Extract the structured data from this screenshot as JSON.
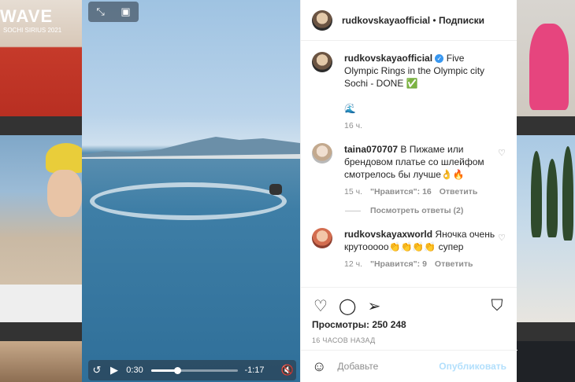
{
  "background": {
    "wave_title": "WAVE",
    "wave_subtitle": "SOCHI SIRIUS 2021"
  },
  "video": {
    "current_time": "0:30",
    "remaining_time": "-1:17",
    "progress": 0.3,
    "icons": [
      "expand-icon",
      "pip-icon",
      "replay-icon",
      "play-icon",
      "more-icon",
      "mute-icon"
    ]
  },
  "post": {
    "author": "rudkovskayaofficial",
    "header_separator": "•",
    "follow_label": "Подписки",
    "caption": {
      "username": "rudkovskayaofficial",
      "text": "Five Olympic Rings in the Olympic city Sochi - DONE ✅",
      "emoji": "🌊",
      "time": "16 ч."
    },
    "comments": [
      {
        "username": "taina070707",
        "text": "В Пижаме или брендовом платье со шлейфом смотрелось бы лучше👌🔥",
        "time": "15 ч.",
        "likes": "\"Нравится\": 16",
        "reply": "Ответить"
      },
      {
        "username": "rudkovskayaxworld",
        "text": "Яночка очень крутооооо👏👏👏👏 супер",
        "time": "12 ч.",
        "likes": "\"Нравится\": 9",
        "reply": "Ответить"
      }
    ],
    "view_replies": "Посмотреть ответы (2)",
    "views": "Просмотры: 250 248",
    "timestamp": "16 ЧАСОВ НАЗАД",
    "add_comment_placeholder": "Добавьте",
    "publish_label": "Опубликовать"
  },
  "colors": {
    "accent": "#3897f0",
    "publish_disabled": "#b2dffc"
  }
}
